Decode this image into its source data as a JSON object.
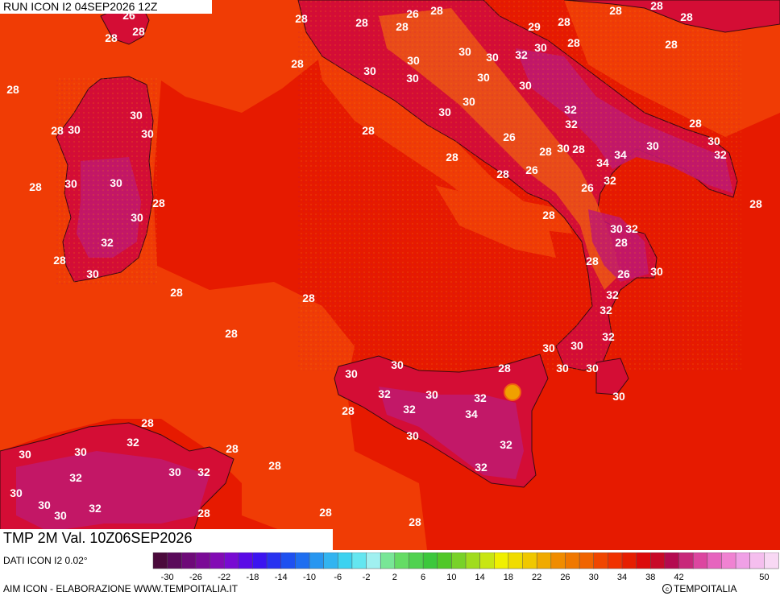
{
  "header": {
    "run_label": "RUN ICON I2 04SEP2026 12Z"
  },
  "map": {
    "title": "TMP 2M Val. 10Z06SEP2026",
    "colors": {
      "sea": "#e61a00",
      "sea_light": "#f03c05",
      "land_hot": "#d40d35",
      "land_very_hot": "#c01a6e",
      "land_mild": "#f06010"
    },
    "temperature_labels": [
      "28",
      "26",
      "28",
      "26",
      "28",
      "28",
      "28",
      "29",
      "28",
      "28",
      "28",
      "28",
      "28",
      "30",
      "30",
      "32",
      "30",
      "30",
      "28",
      "28",
      "26",
      "28",
      "30",
      "28",
      "32",
      "30",
      "30",
      "30",
      "30",
      "28",
      "30",
      "30",
      "30",
      "32",
      "28",
      "34",
      "28",
      "26",
      "34",
      "32",
      "28",
      "28",
      "32",
      "28",
      "28",
      "30",
      "26",
      "26",
      "30",
      "30",
      "30",
      "28",
      "32",
      "30",
      "28",
      "28",
      "30",
      "32",
      "28",
      "26",
      "30",
      "28",
      "32",
      "28",
      "28",
      "32",
      "30",
      "30",
      "32",
      "28",
      "30",
      "30",
      "30",
      "30",
      "32",
      "30",
      "32",
      "28",
      "32",
      "34",
      "30",
      "28",
      "32",
      "30",
      "30",
      "32",
      "30",
      "32",
      "30",
      "32",
      "28",
      "28",
      "28",
      "28",
      "30",
      "32",
      "30",
      "32"
    ]
  },
  "footer": {
    "dati": "DATI ICON I2 0.02°",
    "aim": "AIM ICON - ELABORAZIONE WWW.TEMPOITALIA.IT",
    "copyright_icon": "copyright-icon",
    "copyright": "TEMPOITALIA"
  },
  "scale": {
    "tick_labels": [
      "-30",
      "-26",
      "-22",
      "-18",
      "-14",
      "-10",
      "-6",
      "-2",
      "2",
      "6",
      "10",
      "14",
      "18",
      "22",
      "26",
      "30",
      "34",
      "38",
      "42",
      "50"
    ],
    "colors": [
      "#4b0a3c",
      "#5a0a5a",
      "#6e0a78",
      "#7a0a96",
      "#820ab4",
      "#780ad2",
      "#5a0ae6",
      "#3c14f0",
      "#2832f0",
      "#1e50f0",
      "#1e6ef0",
      "#2896f0",
      "#32b4f0",
      "#3cd2f0",
      "#64e6f0",
      "#a0f0f0",
      "#78e696",
      "#64dc64",
      "#50d250",
      "#3cc83c",
      "#50c828",
      "#78d228",
      "#a0dc1e",
      "#c8e614",
      "#f0f000",
      "#f0dc00",
      "#f0c800",
      "#f0aa00",
      "#f08c00",
      "#f07800",
      "#f06400",
      "#f04600",
      "#f03200",
      "#e61e00",
      "#dc0a0a",
      "#c80a28",
      "#b40a50",
      "#c8287a",
      "#dc46a0",
      "#e664be",
      "#f082d2",
      "#f0a0e6",
      "#f5beee",
      "#f8d8f4"
    ]
  }
}
